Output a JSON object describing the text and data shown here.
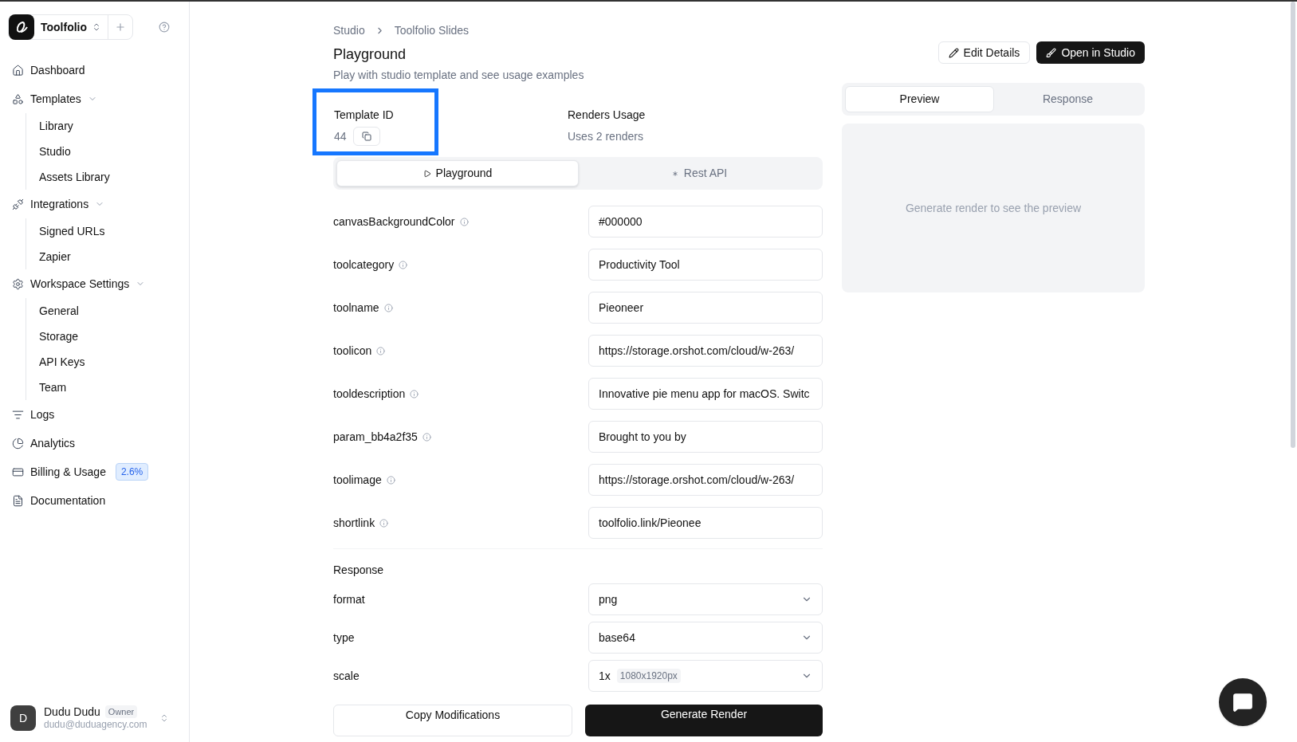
{
  "workspace": {
    "name": "Toolfolio"
  },
  "sidebar": {
    "items": [
      {
        "label": "Dashboard"
      },
      {
        "label": "Templates",
        "expanded": true,
        "children": [
          {
            "label": "Library"
          },
          {
            "label": "Studio"
          },
          {
            "label": "Assets Library"
          }
        ]
      },
      {
        "label": "Integrations",
        "expanded": true,
        "children": [
          {
            "label": "Signed URLs"
          },
          {
            "label": "Zapier"
          }
        ]
      },
      {
        "label": "Workspace Settings",
        "expanded": true,
        "children": [
          {
            "label": "General"
          },
          {
            "label": "Storage"
          },
          {
            "label": "API Keys"
          },
          {
            "label": "Team"
          }
        ]
      },
      {
        "label": "Logs"
      },
      {
        "label": "Analytics"
      },
      {
        "label": "Billing & Usage",
        "badge": "2.6%"
      },
      {
        "label": "Documentation"
      }
    ]
  },
  "user": {
    "initial": "D",
    "name": "Dudu Dudu",
    "role": "Owner",
    "email": "dudu@duduagency.com"
  },
  "breadcrumb": [
    "Studio",
    "Toolfolio Slides"
  ],
  "page": {
    "title": "Playground",
    "subtitle": "Play with studio template and see usage examples"
  },
  "actions": [
    {
      "label": "Edit Details",
      "kind": "outline"
    },
    {
      "label": "Open in Studio",
      "kind": "primary"
    }
  ],
  "template_id": {
    "label": "Template ID",
    "value": "44",
    "highlighted": true
  },
  "renders": {
    "label": "Renders Usage",
    "value": "Uses 2 renders"
  },
  "mode_tabs": [
    {
      "label": "Playground",
      "selected": true
    },
    {
      "label": "Rest API",
      "selected": false
    }
  ],
  "fields": [
    {
      "name": "canvasBackgroundColor",
      "value": "#000000"
    },
    {
      "name": "toolcategory",
      "value": "Productivity Tool"
    },
    {
      "name": "toolname",
      "value": "Pieoneer"
    },
    {
      "name": "toolicon",
      "value": "https://storage.orshot.com/cloud/w-263/"
    },
    {
      "name": "tooldescription",
      "value": "Innovative pie menu app for macOS. Switc"
    },
    {
      "name": "param_bb4a2f35",
      "value": "Brought to you by"
    },
    {
      "name": "toolimage",
      "value": "https://storage.orshot.com/cloud/w-263/"
    },
    {
      "name": "shortlink",
      "value": "toolfolio.link/Pieonee"
    }
  ],
  "response": {
    "title": "Response",
    "options": [
      {
        "name": "format",
        "value": "png"
      },
      {
        "name": "type",
        "value": "base64"
      },
      {
        "name": "scale",
        "value": "1x",
        "hint": "1080x1920px"
      }
    ]
  },
  "bottom_buttons": [
    {
      "label": "Copy Modifications",
      "kind": "outline"
    },
    {
      "label": "Generate Render",
      "kind": "primary"
    }
  ],
  "preview_tabs": [
    {
      "label": "Preview",
      "selected": true
    },
    {
      "label": "Response",
      "selected": false
    }
  ],
  "preview": {
    "message": "Generate render to see the preview"
  }
}
